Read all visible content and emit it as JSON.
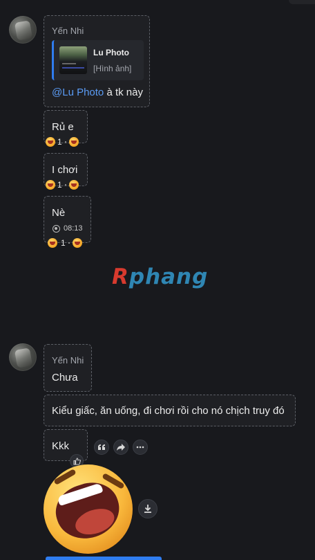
{
  "messages_group_1": {
    "sender": "Yến Nhi",
    "quote": {
      "title": "Lu Photo",
      "subtitle": "[Hình ảnh]"
    },
    "mention_text": "@Lu Photo",
    "mention_suffix": " à tk này",
    "msg2": {
      "text": "Rủ e",
      "react_count": "1"
    },
    "msg3": {
      "text": "I chơi",
      "react_count": "1"
    },
    "msg4": {
      "text": "Nè",
      "time": "08:13",
      "react_count": "1"
    }
  },
  "watermark": {
    "first": "R",
    "rest": "phang"
  },
  "messages_group_2": {
    "sender": "Yến Nhi",
    "msg1": {
      "text": "Chưa"
    },
    "msg2": {
      "text": "Kiểu giấc, ăn uống, đi chơi rồi cho nó chịch truy đó"
    },
    "msg3": {
      "text": "Kkk"
    }
  },
  "actions": {
    "quote_icon": "quote-icon",
    "forward_icon": "forward-icon",
    "more_icon": "more-icon",
    "like_icon": "thumbs-up-icon",
    "download_icon": "download-icon"
  },
  "colors": {
    "accent": "#2f7df0",
    "background": "#18191d"
  }
}
